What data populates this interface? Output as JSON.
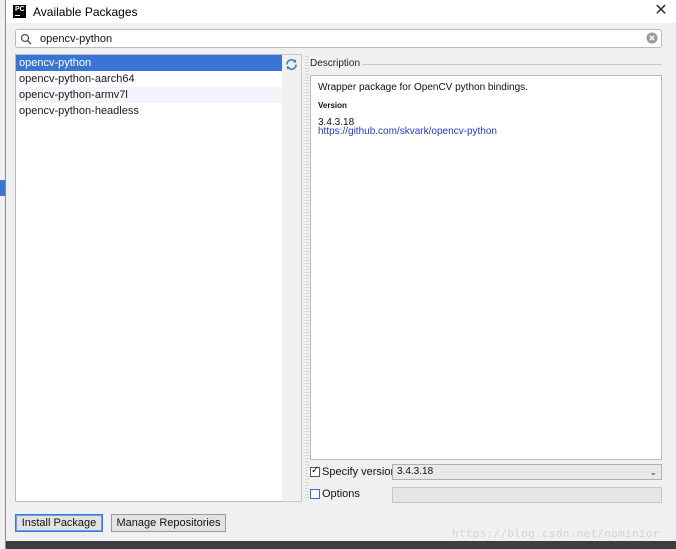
{
  "window": {
    "title": "Available Packages"
  },
  "search": {
    "value": "opencv-python"
  },
  "packages": [
    {
      "name": "opencv-python",
      "selected": true
    },
    {
      "name": "opencv-python-aarch64",
      "selected": false
    },
    {
      "name": "opencv-python-armv7l",
      "selected": false
    },
    {
      "name": "opencv-python-headless",
      "selected": false
    }
  ],
  "description": {
    "section_label": "Description",
    "text": "Wrapper package for OpenCV python bindings.",
    "version_label": "Version",
    "version": "3.4.3.18",
    "url": "https://github.com/skvark/opencv-python"
  },
  "options": {
    "specify_version_label": "Specify version",
    "specify_version_checked": true,
    "selected_version": "3.4.3.18",
    "options_label": "Options",
    "options_checked": false,
    "options_value": ""
  },
  "buttons": {
    "install": "Install Package",
    "manage": "Manage Repositories"
  },
  "watermark": "https://blog.csdn.net/nominior",
  "colors": {
    "selection": "#3875d7",
    "link": "#2a37c9"
  }
}
